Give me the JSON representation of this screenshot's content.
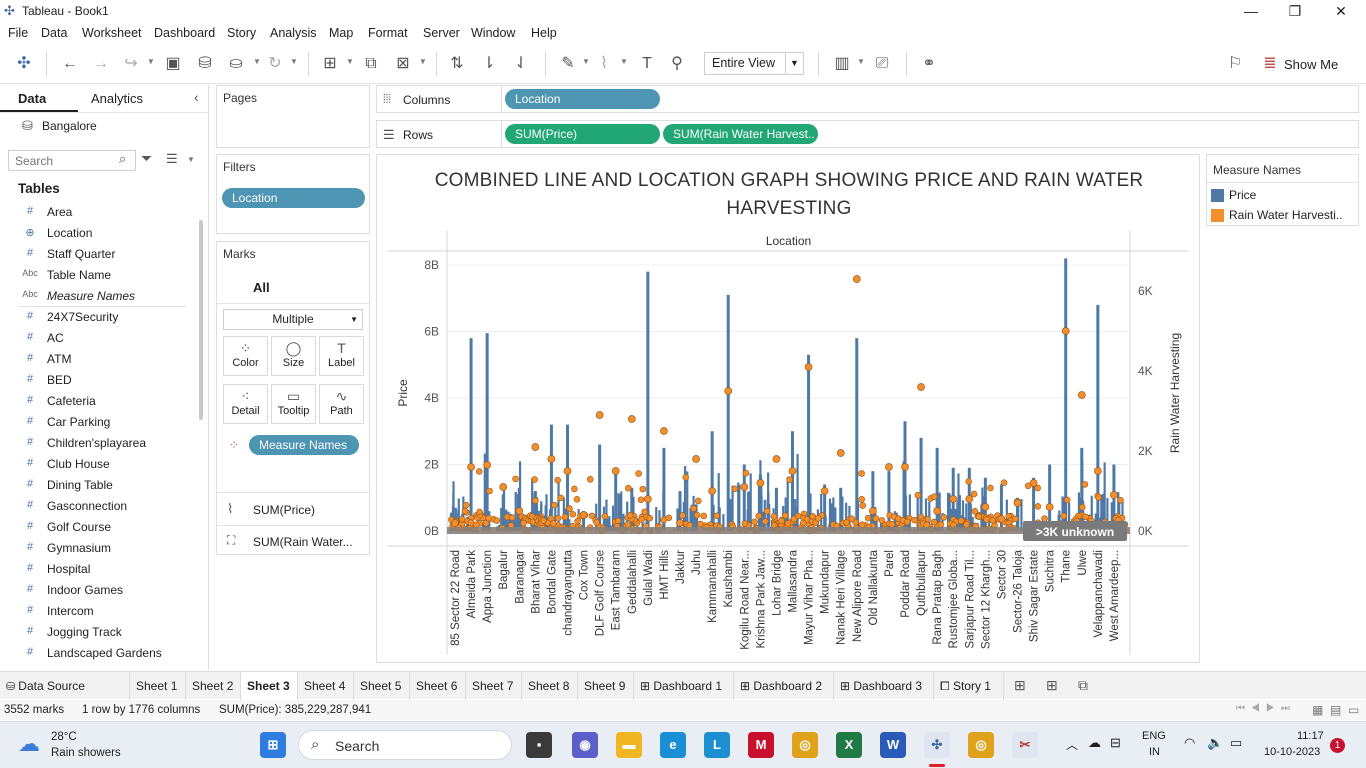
{
  "window": {
    "title": "Tableau - Book1"
  },
  "menu": [
    "File",
    "Data",
    "Worksheet",
    "Dashboard",
    "Story",
    "Analysis",
    "Map",
    "Format",
    "Server",
    "Window",
    "Help"
  ],
  "toolbar": {
    "fit_label": "Entire View",
    "show_me_label": "Show Me"
  },
  "left_pane": {
    "tab_data": "Data",
    "tab_analytics": "Analytics",
    "datasource": "Bangalore",
    "search_placeholder": "Search",
    "tables_header": "Tables",
    "fields": [
      {
        "label": "Area",
        "type": "measure"
      },
      {
        "label": "Location",
        "type": "geo"
      },
      {
        "label": "Staff Quarter",
        "type": "measure"
      },
      {
        "label": "Table Name",
        "type": "dimension"
      },
      {
        "label": "Measure Names",
        "type": "dimension-italic"
      },
      {
        "label": "24X7Security",
        "type": "measure"
      },
      {
        "label": "AC",
        "type": "measure"
      },
      {
        "label": "ATM",
        "type": "measure"
      },
      {
        "label": "BED",
        "type": "measure"
      },
      {
        "label": "Cafeteria",
        "type": "measure"
      },
      {
        "label": "Car Parking",
        "type": "measure"
      },
      {
        "label": "Children'splayarea",
        "type": "measure"
      },
      {
        "label": "Club House",
        "type": "measure"
      },
      {
        "label": "Dining Table",
        "type": "measure"
      },
      {
        "label": "Gasconnection",
        "type": "measure"
      },
      {
        "label": "Golf Course",
        "type": "measure"
      },
      {
        "label": "Gymnasium",
        "type": "measure"
      },
      {
        "label": "Hospital",
        "type": "measure"
      },
      {
        "label": "Indoor Games",
        "type": "measure"
      },
      {
        "label": "Intercom",
        "type": "measure"
      },
      {
        "label": "Jogging Track",
        "type": "measure"
      },
      {
        "label": "Landscaped Gardens",
        "type": "measure"
      }
    ]
  },
  "cards": {
    "pages": "Pages",
    "filters": "Filters",
    "filter_pill": "Location",
    "marks": "Marks",
    "marks_all": "All",
    "mark_type": "Multiple",
    "mark_buttons": [
      "Color",
      "Size",
      "Label",
      "Detail",
      "Tooltip",
      "Path"
    ],
    "measure_names_pill": "Measure Names",
    "mark_rows": [
      "SUM(Price)",
      "SUM(Rain Water..."
    ]
  },
  "shelves": {
    "columns_label": "Columns",
    "columns_pill": "Location",
    "rows_label": "Rows",
    "rows_pill_1": "SUM(Price)",
    "rows_pill_2": "SUM(Rain Water Harvest.."
  },
  "legend": {
    "title": "Measure Names",
    "items": [
      {
        "label": "Price",
        "color": "#4e79a7"
      },
      {
        "label": "Rain Water Harvesti..",
        "color": "#f28e2b"
      }
    ]
  },
  "chart_data": {
    "type": "bar",
    "title": "COMBINED LINE AND LOCATION GRAPH SHOWING PRICE AND RAIN WATER HARVESTING",
    "xlabel": "Location",
    "ylabel": "Price",
    "y2label": "Rain Water Harvesting",
    "ylim": [
      0,
      8300000000
    ],
    "y2lim": [
      0,
      6900
    ],
    "yticks": [
      "8B",
      "6B",
      "4B",
      "2B",
      "0B"
    ],
    "y2ticks": [
      "6K",
      "4K",
      "2K",
      "0K"
    ],
    "unknown_badge": ">3K unknown",
    "categories": [
      "85 Sector 22 Road",
      "Almeida Park",
      "Appa Junction",
      "Bagalur",
      "Baranagar",
      "Bharat Vihar",
      "Bondal Gate",
      "chandrayangutta",
      "Cox Town",
      "DLF Golf Course",
      "East Tambaram",
      "Geddalahalli",
      "Gulal Wadi",
      "HMT Hills",
      "Jakkur",
      "Juhu",
      "Kammanahalli",
      "Kaushambi",
      "Kogilu Road Near...",
      "Krishna Park Jaw...",
      "Lohar Bridge",
      "Mallasandra",
      "Mayur Vihar Pha...",
      "Mukundapur",
      "Nanak Heri Village",
      "New Alipore Road",
      "Old Nallakunta",
      "Parel",
      "Poddar Road",
      "Quthbullapur",
      "Rana Pratap Bagh",
      "Rustomjee Globa...",
      "Sarjapur Road Til...",
      "Sector 12 Khargh...",
      "Sector 30",
      "Sector-26 Taloja",
      "Shiv Sagar Estate",
      "Suchitra",
      "Thane",
      "Ulwe",
      "Velappanchavadi",
      "West Amardeep..."
    ],
    "series": [
      {
        "name": "Price",
        "values": [
          400000000,
          5800000000,
          5950000000,
          1100000000,
          1300000000,
          1200000000,
          3200000000,
          3200000000,
          600000000,
          2600000000,
          1800000000,
          1300000000,
          7800000000,
          2500000000,
          1200000000,
          800000000,
          3000000000,
          7100000000,
          2000000000,
          1700000000,
          1300000000,
          3000000000,
          5300000000,
          1400000000,
          1300000000,
          5800000000,
          1800000000,
          1800000000,
          3300000000,
          2800000000,
          2500000000,
          1900000000,
          1900000000,
          1600000000,
          1400000000,
          1000000000,
          1600000000,
          2000000000,
          8200000000,
          2500000000,
          6800000000,
          2000000000
        ]
      },
      {
        "name": "Rain Water Harvesting",
        "values": [
          200,
          1600,
          1650,
          1100,
          500,
          2100,
          1800,
          1500,
          400,
          2900,
          1500,
          2800,
          800,
          2500,
          200,
          1800,
          1000,
          3500,
          1100,
          1200,
          1800,
          1500,
          4100,
          1000,
          1950,
          6300,
          500,
          1600,
          1600,
          3600,
          500,
          800,
          800,
          600,
          300,
          700,
          1200,
          600,
          5000,
          3400,
          1500,
          900
        ]
      }
    ]
  },
  "sheet_tabs": [
    "Data Source",
    "Sheet 1",
    "Sheet 2",
    "Sheet 3",
    "Sheet 4",
    "Sheet 5",
    "Sheet 6",
    "Sheet 7",
    "Sheet 8",
    "Sheet 9",
    "Dashboard 1",
    "Dashboard 2",
    "Dashboard 3",
    "Story 1"
  ],
  "status": {
    "marks": "3552 marks",
    "dims": "1 row by 1776 columns",
    "sum": "SUM(Price): 385,229,287,941"
  },
  "taskbar": {
    "weather_temp": "28°C",
    "weather_desc": "Rain showers",
    "search_label": "Search",
    "lang_1": "ENG",
    "lang_2": "IN",
    "time": "11:17",
    "date": "10-10-2023",
    "notif_count": "1"
  }
}
